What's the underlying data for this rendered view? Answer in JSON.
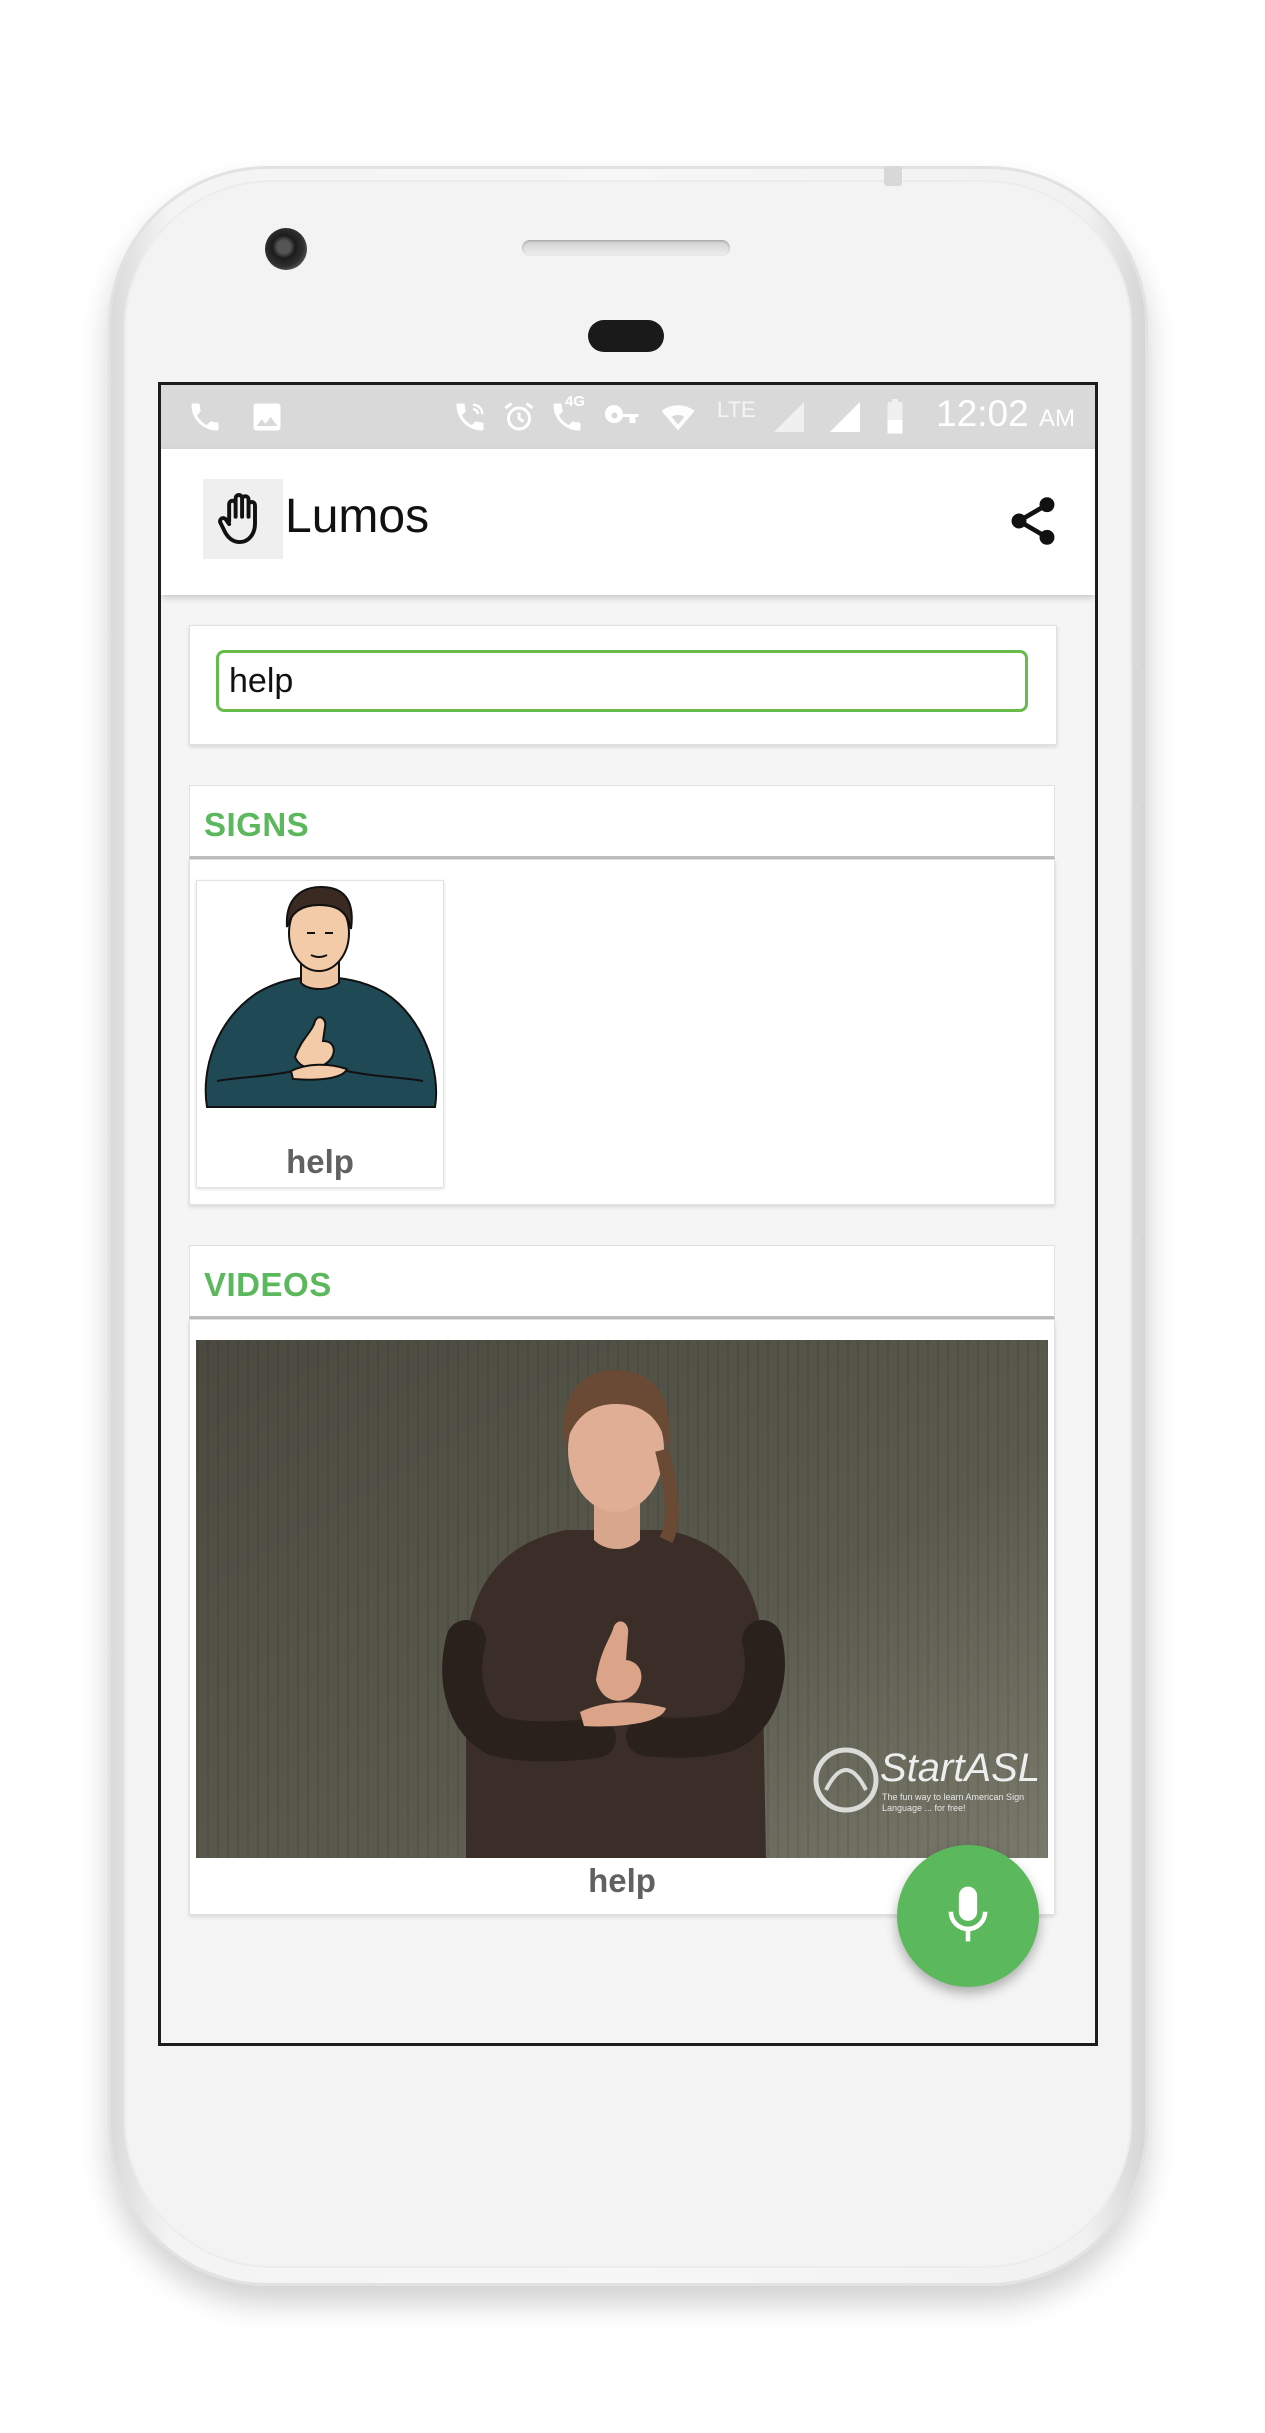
{
  "status_bar": {
    "time": "12:02",
    "ampm": "AM",
    "network_label": "LTE",
    "network_type": "4G",
    "icons": [
      "phone-icon",
      "image-icon",
      "wifi-call-icon",
      "alarm-icon",
      "volte-icon",
      "vpn-key-icon",
      "wifi-icon",
      "signal-icon",
      "signal-icon",
      "battery-icon"
    ]
  },
  "app_bar": {
    "title": "Lumos",
    "logo_icon": "hand-icon",
    "share_icon": "share-icon"
  },
  "search": {
    "value": "help"
  },
  "signs": {
    "heading": "SIGNS",
    "items": [
      {
        "caption": "help"
      }
    ]
  },
  "videos": {
    "heading": "VIDEOS",
    "items": [
      {
        "caption": "help",
        "watermark": "StartASL",
        "watermark_tagline": "The fun way to learn American Sign Language ... for free!"
      }
    ]
  },
  "fab": {
    "icon": "microphone-icon"
  },
  "colors": {
    "accent": "#5cb85c",
    "search_border": "#66bb4a",
    "status_bar": "#d9d9d9"
  }
}
